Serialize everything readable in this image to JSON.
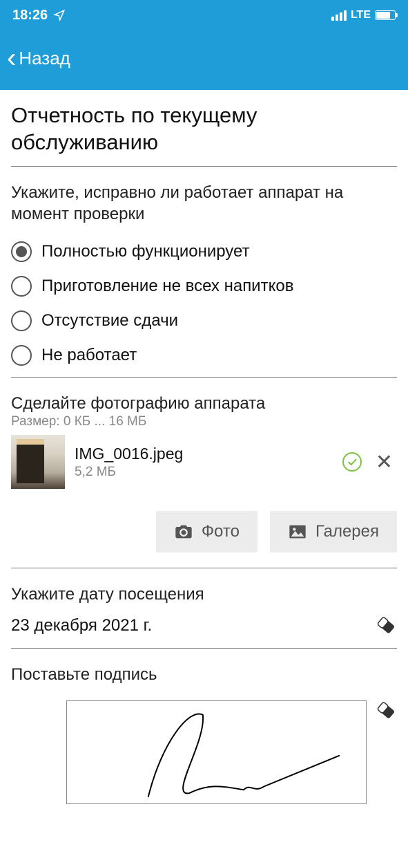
{
  "status": {
    "time": "18:26",
    "network": "LTE"
  },
  "nav": {
    "back_label": "Назад"
  },
  "page": {
    "title": "Отчетность по текущему обслуживанию"
  },
  "question1": {
    "label": "Укажите, исправно ли работает аппарат на момент проверки",
    "options": [
      "Полностью функционирует",
      "Приготовление не всех напитков",
      "Отсутствие сдачи",
      "Не работает"
    ],
    "selected_index": 0
  },
  "photo_section": {
    "label": "Сделайте фотографию аппарата",
    "hint": "Размер: 0 КБ ... 16 МБ",
    "file": {
      "name": "IMG_0016.jpeg",
      "size": "5,2 МБ"
    },
    "photo_btn": "Фото",
    "gallery_btn": "Галерея"
  },
  "date_section": {
    "label": "Укажите дату посещения",
    "value": "23 декабря 2021 г."
  },
  "signature_section": {
    "label": "Поставьте подпись"
  }
}
